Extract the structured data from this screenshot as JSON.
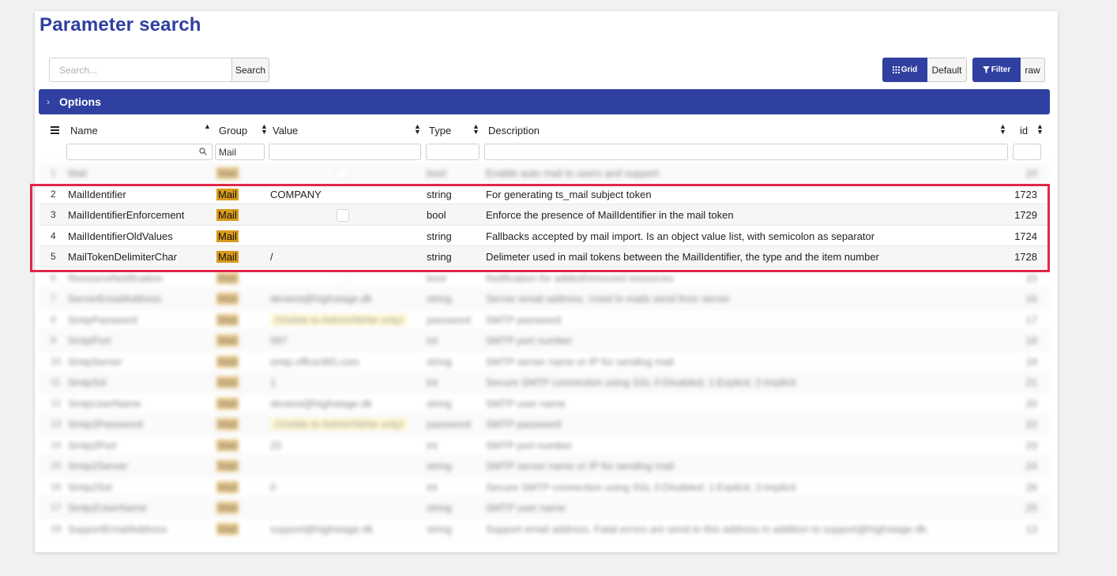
{
  "page": {
    "title": "Parameter search"
  },
  "search": {
    "placeholder": "Search...",
    "button_label": "Search"
  },
  "view_toggle": {
    "grid_label": "Grid",
    "default_label": "Default"
  },
  "filter_toggle": {
    "filter_label": "Filter",
    "raw_label": "raw"
  },
  "options": {
    "label": "Options"
  },
  "table": {
    "columns": {
      "name": "Name",
      "group": "Group",
      "value": "Value",
      "type": "Type",
      "description": "Description",
      "id": "id"
    },
    "filters": {
      "group": "Mail"
    },
    "rows": [
      {
        "num": "1",
        "name": "Mail",
        "group": "Mail",
        "value": "",
        "type": "bool",
        "description": "Enable auto mail to users and support",
        "id": "10"
      },
      {
        "num": "2",
        "name": "MailIdentifier",
        "group": "Mail",
        "value": "COMPANY",
        "type": "string",
        "description": "For generating ts_mail subject token",
        "id": "1723"
      },
      {
        "num": "3",
        "name": "MailIdentifierEnforcement",
        "group": "Mail",
        "value": "",
        "type": "bool",
        "description": "Enforce the presence of MailIdentifier in the mail token",
        "id": "1729"
      },
      {
        "num": "4",
        "name": "MailIdentifierOldValues",
        "group": "Mail",
        "value": "",
        "type": "string",
        "description": "Fallbacks accepted by mail import. Is an object value list, with semicolon as separator",
        "id": "1724"
      },
      {
        "num": "5",
        "name": "MailTokenDelimiterChar",
        "group": "Mail",
        "value": "/",
        "type": "string",
        "description": "Delimeter used in mail tokens between the MailIdentifier, the type and the item number",
        "id": "1728"
      },
      {
        "num": "6",
        "name": "ResourceNotification",
        "group": "Mail",
        "value": "",
        "type": "bool",
        "description": "Notification for added/removed resources",
        "id": "15"
      },
      {
        "num": "7",
        "name": "ServerEmailAddress",
        "group": "Mail",
        "value": "devtest@highstage.dk",
        "type": "string",
        "description": "Server email address. Used in mails send from server",
        "id": "16"
      },
      {
        "num": "8",
        "name": "SmtpPassword",
        "group": "Mail",
        "value": "(Visible to Admin/Write only)",
        "type": "password",
        "description": "SMTP password",
        "id": "17"
      },
      {
        "num": "9",
        "name": "SmtpPort",
        "group": "Mail",
        "value": "587",
        "type": "int",
        "description": "SMTP port number",
        "id": "18"
      },
      {
        "num": "10",
        "name": "SmtpServer",
        "group": "Mail",
        "value": "smtp.office365.com",
        "type": "string",
        "description": "SMTP server name or IP for sending mail",
        "id": "19"
      },
      {
        "num": "11",
        "name": "SmtpSsl",
        "group": "Mail",
        "value": "1",
        "type": "int",
        "description": "Secure SMTP connection using SSL 0:Disabled; 1:Explicit; 2:Implicit",
        "id": "21"
      },
      {
        "num": "12",
        "name": "SmtpUserName",
        "group": "Mail",
        "value": "devtest@highstage.dk",
        "type": "string",
        "description": "SMTP user name",
        "id": "20"
      },
      {
        "num": "13",
        "name": "Smtp2Password",
        "group": "Mail",
        "value": "(Visible to Admin/Write only)",
        "type": "password",
        "description": "SMTP password",
        "id": "22"
      },
      {
        "num": "14",
        "name": "Smtp2Port",
        "group": "Mail",
        "value": "25",
        "type": "int",
        "description": "SMTP port number",
        "id": "23"
      },
      {
        "num": "15",
        "name": "Smtp2Server",
        "group": "Mail",
        "value": "",
        "type": "string",
        "description": "SMTP server name or IP for sending mail",
        "id": "24"
      },
      {
        "num": "16",
        "name": "Smtp2Ssl",
        "group": "Mail",
        "value": "0",
        "type": "int",
        "description": "Secure SMTP connection using SSL 0:Disabled; 1:Explicit; 2:Implicit",
        "id": "26"
      },
      {
        "num": "17",
        "name": "Smtp2UserName",
        "group": "Mail",
        "value": "",
        "type": "string",
        "description": "SMTP user name",
        "id": "25"
      },
      {
        "num": "18",
        "name": "SupportEmailAddress",
        "group": "Mail",
        "value": "support@highstage.dk",
        "type": "string",
        "description": "Support email address. Fatal errors are send to this address in addition to support@highstage.dk.",
        "id": "13"
      }
    ]
  },
  "colors": {
    "brand": "#3040a0",
    "group_chip": "#d99a1c",
    "highlight": "#e0284a",
    "password_chip": "#fff2a8"
  }
}
